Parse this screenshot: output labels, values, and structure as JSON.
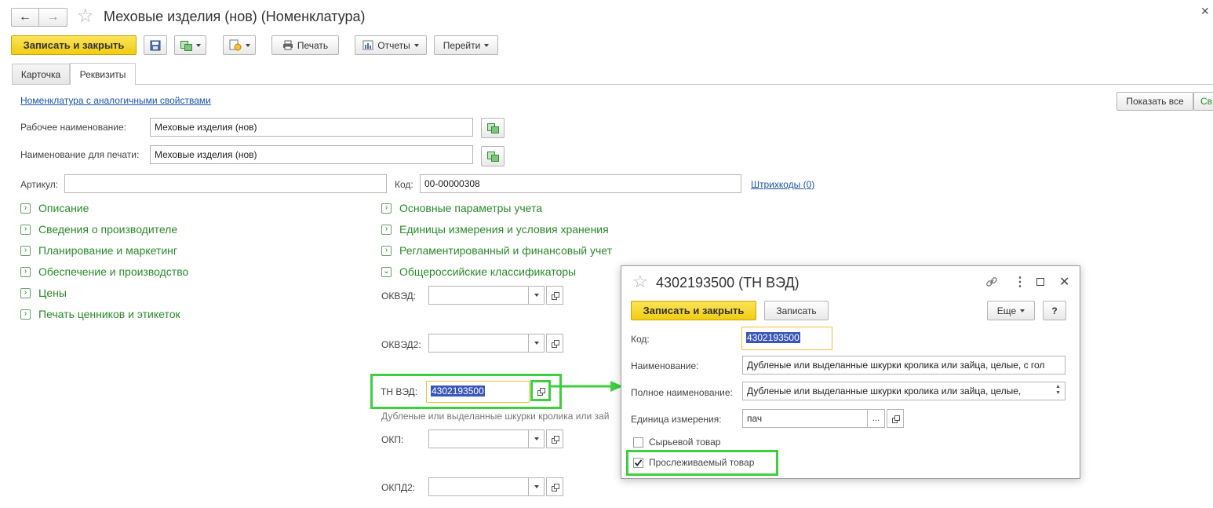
{
  "window": {
    "title": "Меховые изделия (нов) (Номенклатура)",
    "nav_back": "←",
    "nav_forward": "→",
    "star": "☆"
  },
  "toolbar": {
    "save_close": "Записать и закрыть",
    "print": "Печать",
    "reports": "Отчеты",
    "goto": "Перейти"
  },
  "tabs": [
    {
      "label": "Карточка",
      "active": false
    },
    {
      "label": "Реквизиты",
      "active": true
    }
  ],
  "form": {
    "similar_link": "Номенклатура с аналогичными свойствами",
    "show_all": "Показать все",
    "right_cut_button": "Св",
    "work_name_label": "Рабочее наименование:",
    "work_name_value": "Меховые изделия (нов)",
    "print_name_label": "Наименование для печати:",
    "print_name_value": "Меховые изделия (нов)",
    "article_label": "Артикул:",
    "article_value": "",
    "code_label": "Код:",
    "code_value": "00-00000308",
    "barcodes_link": "Штрихкоды (0)"
  },
  "groups_left": [
    "Описание",
    "Сведения о производителе",
    "Планирование и маркетинг",
    "Обеспечение и производство",
    "Цены",
    "Печать ценников и этикеток"
  ],
  "groups_right": [
    "Основные параметры учета",
    "Единицы измерения и условия хранения",
    "Регламентированный и финансовый учет"
  ],
  "classifiers": {
    "title": "Общероссийские классификаторы",
    "okved_label": "ОКВЭД:",
    "okved2_label": "ОКВЭД2:",
    "tnved_label": "ТН ВЭД:",
    "tnved_value": "4302193500",
    "tnved_desc": "Дубленые или выделанные шкурки кролика или зай",
    "okp_label": "ОКП:",
    "okpd2_label": "ОКПД2:"
  },
  "dialog": {
    "title": "4302193500 (ТН ВЭД)",
    "star": "☆",
    "save_close": "Записать и закрыть",
    "save": "Записать",
    "more": "Еще",
    "help": "?",
    "code_label": "Код:",
    "code_value": "4302193500",
    "name_label": "Наименование:",
    "name_value": "Дубленые или выделанные шкурки кролика или зайца, целые, с гол",
    "full_name_label": "Полное наименование:",
    "full_name_value": "Дубленые или выделанные шкурки кролика или зайца, целые,",
    "unit_label": "Единица измерения:",
    "unit_value": "пач",
    "unit_select": "...",
    "raw_goods_label": "Сырьевой товар",
    "raw_goods_checked": false,
    "tracked_label": "Прослеживаемый товар",
    "tracked_checked": true
  },
  "colors": {
    "accent_yellow": "#f2cd12",
    "group_green": "#2a8a2a",
    "highlight_green": "#3ecf3e",
    "selection_blue": "#3a57b8"
  }
}
